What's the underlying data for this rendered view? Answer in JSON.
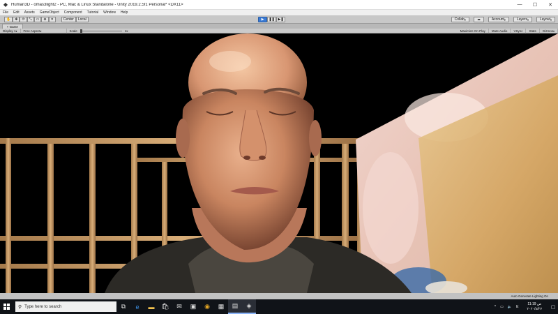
{
  "window": {
    "title": "Human3D - omas3light2 - PC, Mac & Linux Standalone - Unity 2019.2.5f1 Personal* <DX11>",
    "minimize": "—",
    "maximize": "☐",
    "close": "✕"
  },
  "menu": [
    "File",
    "Edit",
    "Assets",
    "GameObject",
    "Component",
    "Tutorial",
    "Window",
    "Help"
  ],
  "toolbar": {
    "pivot": "Center",
    "space": "Local",
    "collab": "Collab",
    "account": "Account",
    "layers": "Layers",
    "layout": "Layout"
  },
  "tab": {
    "label": "Game"
  },
  "gamebar": {
    "display": "Display 1",
    "aspect": "Free Aspect",
    "scale_label": "Scale",
    "scale_value": "1x",
    "maximize": "Maximize On Play",
    "mute": "Mute Audio",
    "vsync": "VSync",
    "stats": "Stats",
    "gizmos": "Gizmos"
  },
  "status": {
    "text": "Auto Generate Lighting On"
  },
  "taskbar": {
    "search_placeholder": "Type here to search",
    "lang": "E",
    "time": "11:19 ص",
    "date": "۲۰۲۰/۸/۲۷"
  },
  "colors": {
    "play_accent": "#3b7bd5",
    "taskbar_bg": "#101318"
  }
}
